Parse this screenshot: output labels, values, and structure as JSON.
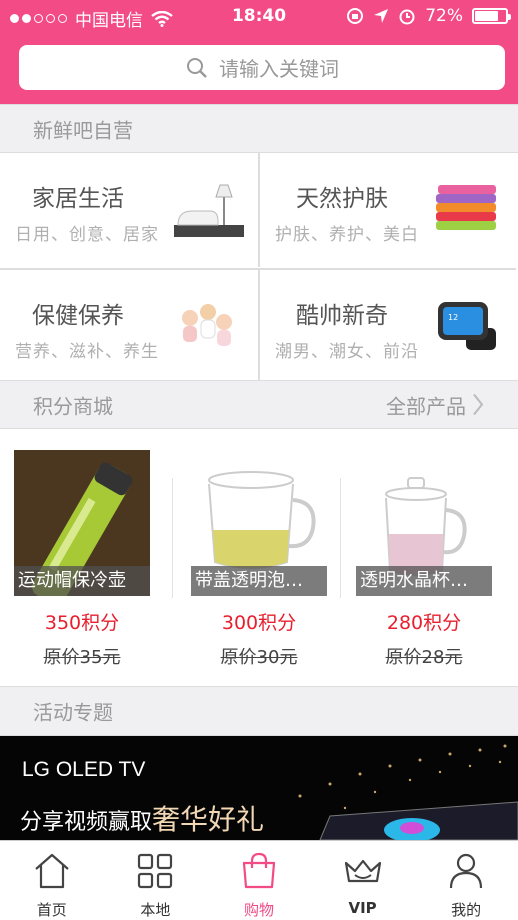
{
  "status_bar": {
    "carrier": "中国电信",
    "time": "18:40",
    "battery": "72%",
    "battery_level": 0.72
  },
  "search": {
    "placeholder": "请输入关键词"
  },
  "sections": {
    "fresh": "新鲜吧自营",
    "points_mall": "积分商城",
    "points_more": "全部产品",
    "activity": "活动专题"
  },
  "categories": [
    {
      "name": "家居生活",
      "sub": "日用、创意、居家",
      "icon": "sofa-lamp-icon"
    },
    {
      "name": "天然护肤",
      "sub": "护肤、养护、美白",
      "icon": "towels-icon"
    },
    {
      "name": "保健保养",
      "sub": "营养、滋补、养生",
      "icon": "babies-icon"
    },
    {
      "name": "酷帅新奇",
      "sub": "潮男、潮女、前沿",
      "icon": "smartwatch-icon"
    }
  ],
  "products": [
    {
      "name": "运动帽保冷壶",
      "price": "350积分",
      "original": "原价35元"
    },
    {
      "name": "带盖透明泡…",
      "price": "300积分",
      "original": "原价30元"
    },
    {
      "name": "透明水晶杯…",
      "price": "280积分",
      "original": "原价28元"
    }
  ],
  "banner": {
    "brand": "LG OLED TV",
    "slogan_prefix": "分享视频赢取",
    "slogan_highlight": "奢华好礼"
  },
  "tabs": [
    {
      "label": "首页",
      "icon": "home-icon"
    },
    {
      "label": "本地",
      "icon": "grid-icon"
    },
    {
      "label": "购物",
      "icon": "shopping-bag-icon",
      "active": true
    },
    {
      "label": "VIP",
      "icon": "crown-icon"
    },
    {
      "label": "我的",
      "icon": "user-icon"
    }
  ],
  "colors": {
    "brand": "#f24b86",
    "price": "#e8202e",
    "section_bg": "#f0f0f2"
  }
}
